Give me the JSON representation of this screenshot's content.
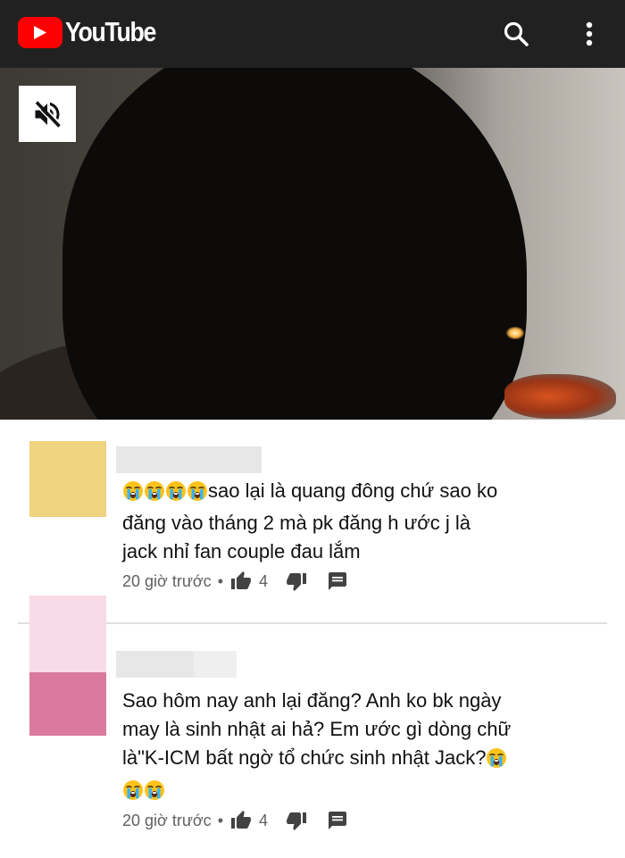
{
  "app": {
    "name": "YouTube",
    "brand_color": "#ff0000",
    "header_color": "#212121"
  },
  "header": {
    "icons": [
      "search-icon",
      "more-vert-icon"
    ]
  },
  "video": {
    "muted": true,
    "icon": "volume-off-icon"
  },
  "comments": [
    {
      "avatar_color": "#f0d37e",
      "emoji_count": 4,
      "emoji": "loudly-crying-face",
      "lines": [
        "sao lại là quang đông chứ sao ko",
        "đăng vào tháng 2 mà pk đăng h ước j là",
        "jack nhỉ fan couple đau lắm"
      ],
      "time": "20 giờ trước",
      "separator": "•",
      "likes": "4"
    },
    {
      "avatar_color": "#d97a9e",
      "avatar_top_color": "#f7dbe6",
      "lines": [
        "Sao hôm nay anh lại đăng? Anh ko bk ngày",
        "may là sinh nhật ai hả? Em ước gì dòng chữ",
        "là\"K-ICM bất ngờ tổ chức sinh nhật Jack?"
      ],
      "trailing_emoji_count": 3,
      "emoji": "loudly-crying-face",
      "time": "20 giờ trước",
      "separator": "•",
      "likes": "4"
    }
  ]
}
